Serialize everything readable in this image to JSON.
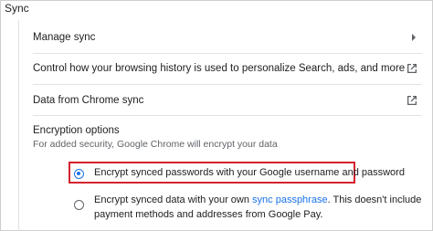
{
  "section": {
    "title": "Sync"
  },
  "rows": [
    {
      "label": "Manage sync",
      "icon": "chevron-right-icon"
    },
    {
      "label": "Control how your browsing history is used to personalize Search, ads, and more",
      "icon": "external-link-icon"
    },
    {
      "label": "Data from Chrome sync",
      "icon": "external-link-icon"
    }
  ],
  "encryption": {
    "title": "Encryption options",
    "description": "For added security, Google Chrome will encrypt your data",
    "options": [
      {
        "label": "Encrypt synced passwords with your Google username and password",
        "selected": true
      },
      {
        "label_before": "Encrypt synced data with your own ",
        "link": "sync passphrase",
        "label_after": ". This doesn't include payment methods and addresses from Google Pay.",
        "selected": false
      }
    ],
    "highlight_color": "#d3232f"
  },
  "colors": {
    "accent": "#1a73e8",
    "text": "#202124",
    "secondary_text": "#5f6368"
  }
}
